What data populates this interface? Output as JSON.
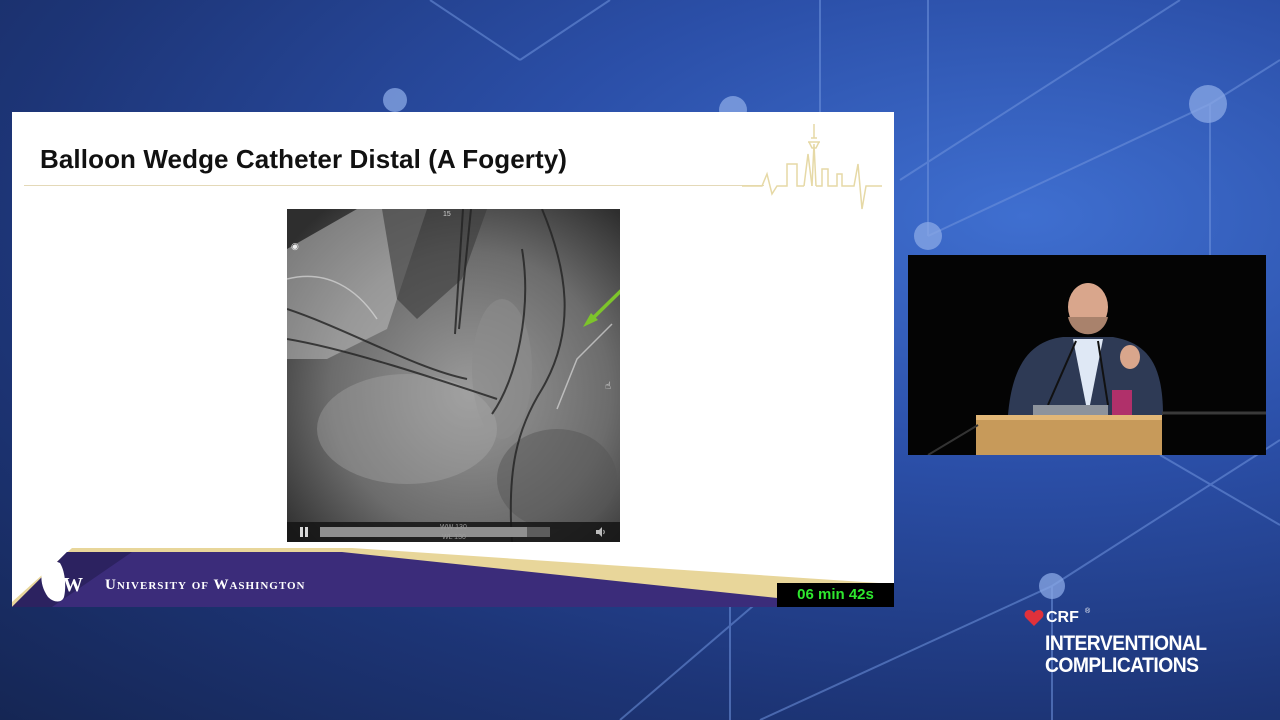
{
  "slide": {
    "title": "Balloon Wedge Catheter Distal (A Fogerty)",
    "footer_org": "University of Washington",
    "video_player": {
      "frame_number": "15",
      "ww_label": "WW 130",
      "wl_label": "WL 130",
      "progress": 0.9,
      "state": "playing",
      "pause_icon": "pause-icon",
      "volume_icon": "volume-icon"
    },
    "annotation": {
      "icon": "green-arrow-icon",
      "color": "#7dc42b"
    }
  },
  "timer": {
    "text": "06 min 42s",
    "color": "#2ee82e"
  },
  "brand": {
    "crf": "CRF",
    "reg": "®",
    "line1": "INTERVENTIONAL",
    "line2": "COMPLICATIONS",
    "heart_color": "#e0313b"
  },
  "colors": {
    "uw_purple": "#4b2e83",
    "uw_gold": "#e8d69a",
    "background": "#2b4fa8"
  }
}
